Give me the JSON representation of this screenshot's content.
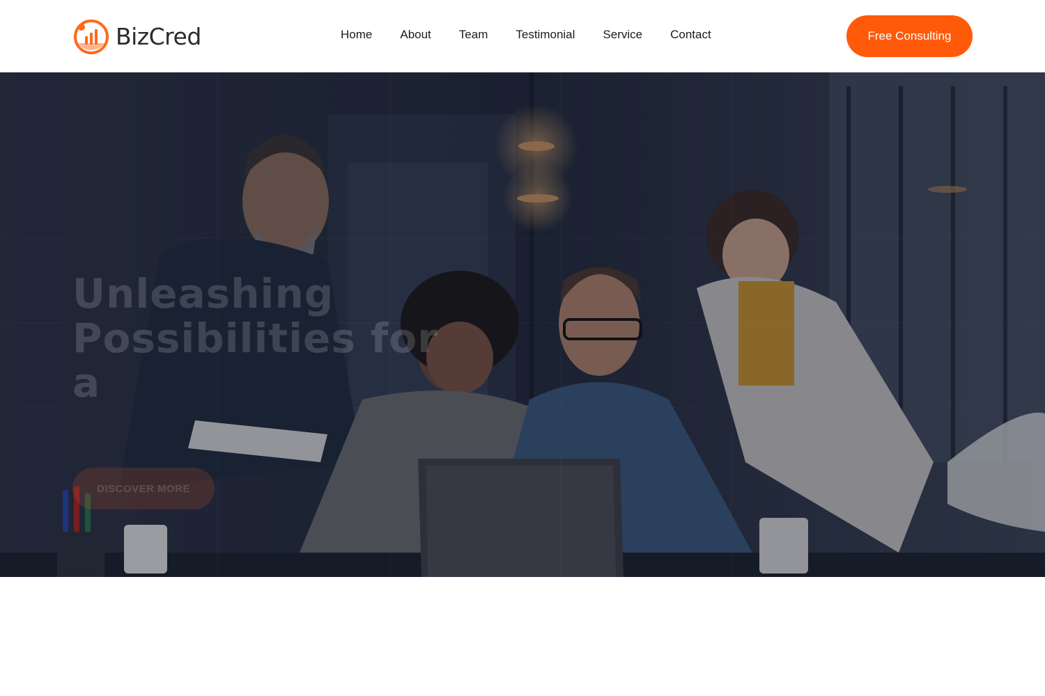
{
  "brand": {
    "name": "BizCred",
    "accent_color": "#ff5a0a",
    "logo_icon": "growth-chart-logo-icon"
  },
  "nav": {
    "items": [
      {
        "label": "Home"
      },
      {
        "label": "About"
      },
      {
        "label": "Team"
      },
      {
        "label": "Testimonial"
      },
      {
        "label": "Service"
      },
      {
        "label": "Contact"
      }
    ]
  },
  "header": {
    "cta_label": "Free Consulting"
  },
  "hero": {
    "title_line1": "Unleashing",
    "title_line2": "Possibilities for a",
    "button_label": "DISCOVER MORE",
    "image_subject": "team-meeting-photo"
  }
}
